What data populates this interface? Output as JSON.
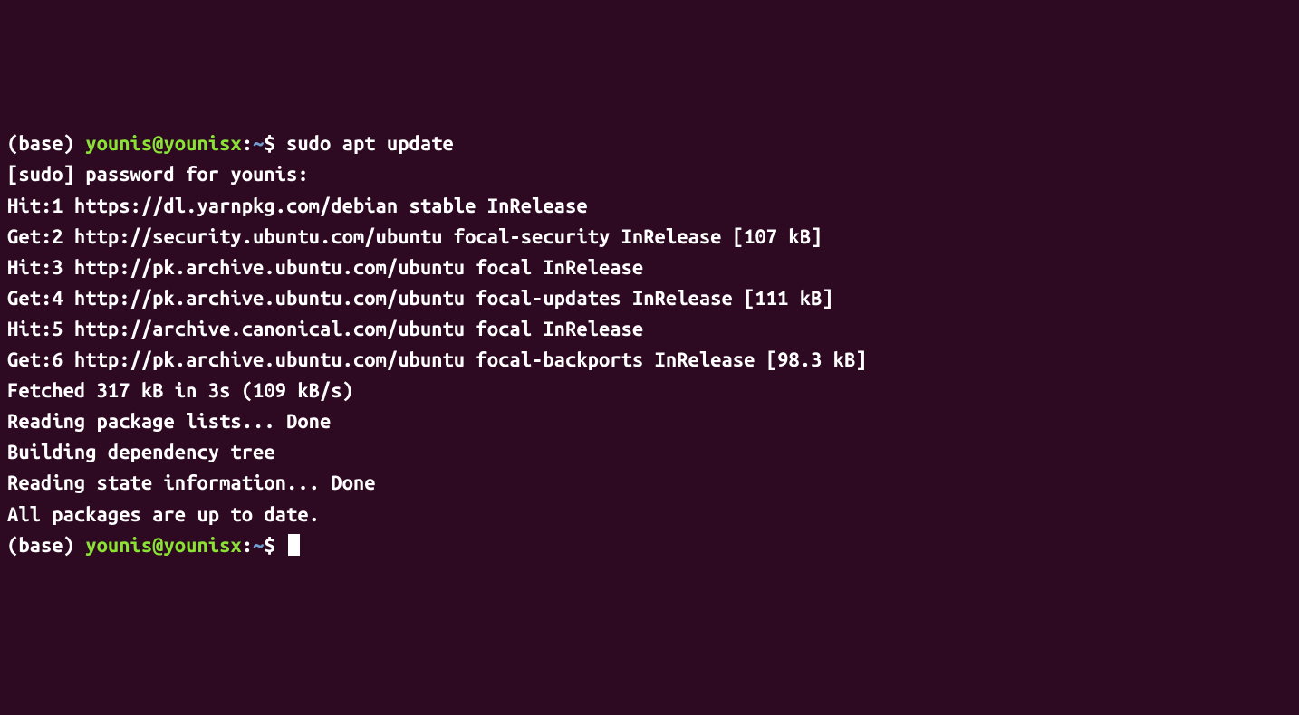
{
  "prompt1": {
    "env": "(base) ",
    "userhost": "younis@younisx",
    "colon": ":",
    "cwd": "~",
    "dollar": "$ ",
    "command": "sudo apt update"
  },
  "output": [
    "[sudo] password for younis:",
    "Hit:1 https://dl.yarnpkg.com/debian stable InRelease",
    "Get:2 http://security.ubuntu.com/ubuntu focal-security InRelease [107 kB]",
    "Hit:3 http://pk.archive.ubuntu.com/ubuntu focal InRelease",
    "Get:4 http://pk.archive.ubuntu.com/ubuntu focal-updates InRelease [111 kB]",
    "Hit:5 http://archive.canonical.com/ubuntu focal InRelease",
    "Get:6 http://pk.archive.ubuntu.com/ubuntu focal-backports InRelease [98.3 kB]",
    "Fetched 317 kB in 3s (109 kB/s)",
    "Reading package lists... Done",
    "Building dependency tree",
    "Reading state information... Done",
    "All packages are up to date."
  ],
  "prompt2": {
    "env": "(base) ",
    "userhost": "younis@younisx",
    "colon": ":",
    "cwd": "~",
    "dollar": "$ "
  }
}
